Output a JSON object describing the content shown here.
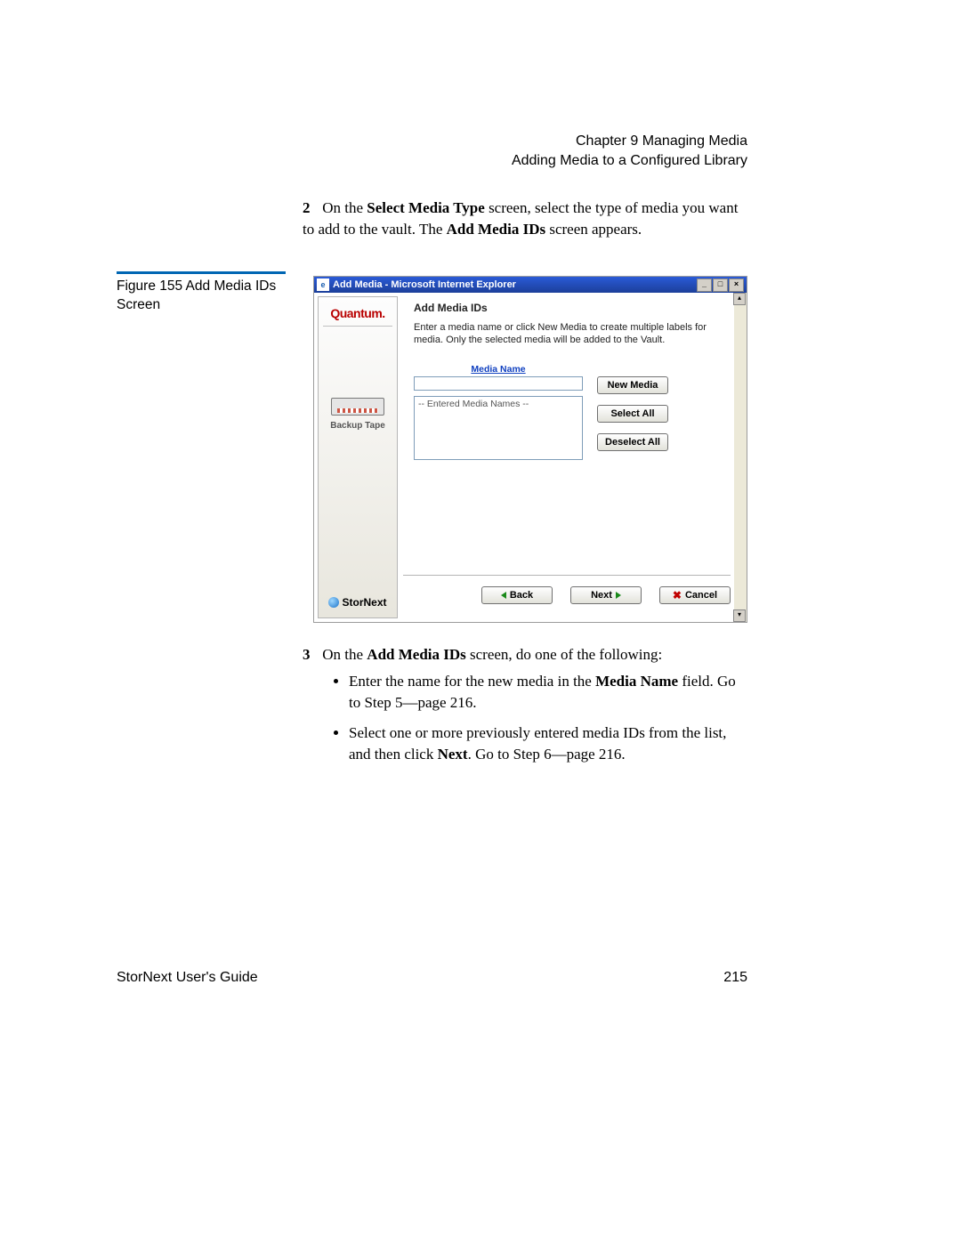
{
  "header": {
    "chapter": "Chapter 9  Managing Media",
    "section": "Adding Media to a Configured Library"
  },
  "step2": {
    "num": "2",
    "text_pre": "On the ",
    "bold1": "Select Media Type",
    "text_mid": " screen, select the type of media you want to add to the vault. The ",
    "bold2": "Add Media IDs",
    "text_post": " screen appears."
  },
  "figure_caption": "Figure 155  Add Media IDs Screen",
  "window": {
    "title": "Add Media - Microsoft Internet Explorer",
    "min": "_",
    "max": "□",
    "close": "×",
    "sidebar": {
      "brand": "Quantum.",
      "tape_label": "Backup Tape",
      "product": "StorNext"
    },
    "panel": {
      "heading": "Add Media IDs",
      "instructions": "Enter a media name or click New Media to create multiple labels for media. Only the selected media will be added to the Vault.",
      "media_name_label": "Media Name",
      "list_placeholder": "-- Entered Media Names --",
      "buttons": {
        "new_media": "New Media",
        "select_all": "Select All",
        "deselect_all": "Deselect All"
      }
    },
    "footer": {
      "back": "Back",
      "next": "Next",
      "cancel": "Cancel"
    }
  },
  "step3": {
    "num": "3",
    "lead_pre": "On the ",
    "lead_bold": "Add Media IDs",
    "lead_post": " screen, do one of the following:",
    "bullet1_pre": "Enter the name for the new media in the ",
    "bullet1_bold": "Media Name",
    "bullet1_post": " field. Go to Step 5—page 216.",
    "bullet2_pre": "Select one or more previously entered media IDs from the list, and then click ",
    "bullet2_bold": "Next",
    "bullet2_post": ". Go to Step 6—page 216."
  },
  "footer": {
    "guide": "StorNext User's Guide",
    "page": "215"
  }
}
